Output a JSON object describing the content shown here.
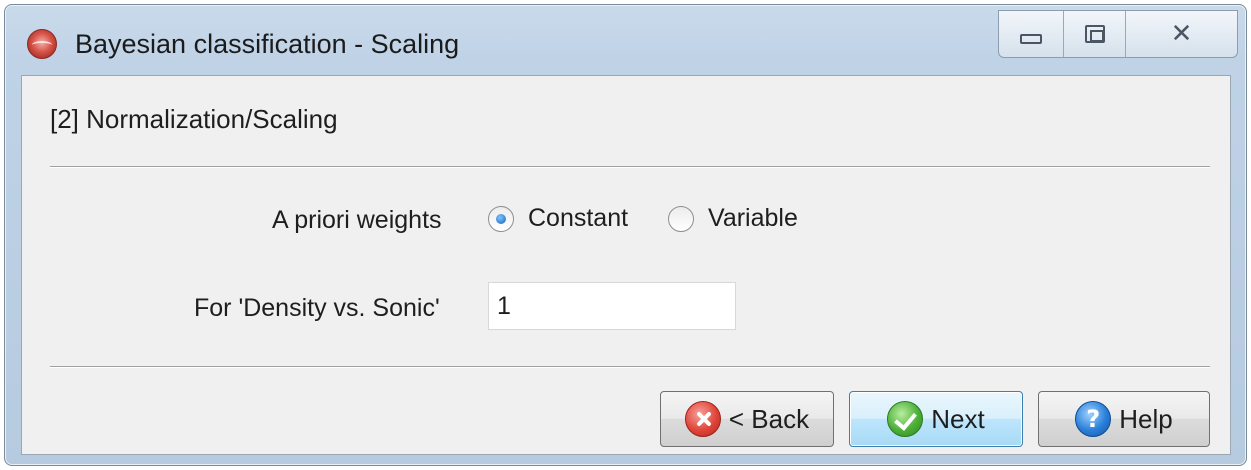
{
  "window": {
    "title": "Bayesian classification - Scaling",
    "controls": {
      "minimize": "minimize",
      "maximize": "maximize",
      "close": "close"
    }
  },
  "step": {
    "title": "[2] Normalization/Scaling"
  },
  "weights": {
    "label": "A priori weights",
    "options": [
      {
        "label": "Constant",
        "selected": true
      },
      {
        "label": "Variable",
        "selected": false
      }
    ]
  },
  "density": {
    "label": "For 'Density vs. Sonic'",
    "value": "1"
  },
  "buttons": {
    "back": {
      "label": "< Back",
      "icon": "error-x-icon"
    },
    "next": {
      "label": "Next",
      "icon": "checkmark-icon"
    },
    "help": {
      "label": "Help",
      "icon": "question-icon"
    }
  }
}
